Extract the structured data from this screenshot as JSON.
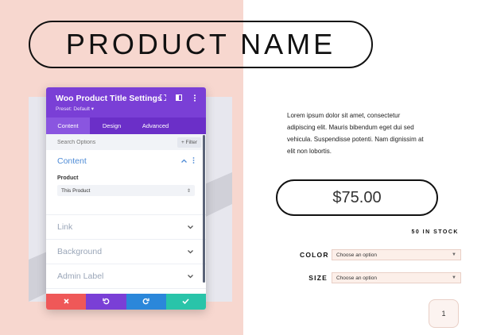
{
  "product": {
    "title": "PRODUCT NAME",
    "description": "Lorem ipsum dolor sit amet, consectetur adipiscing elit. Mauris bibendum eget dui sed vehicula. Suspendisse potenti. Nam dignissim at elit non lobortis.",
    "price": "$75.00",
    "stock": "50 IN STOCK",
    "variations": [
      {
        "label": "COLOR",
        "value": "Choose an option"
      },
      {
        "label": "SIZE",
        "value": "Choose an option"
      }
    ],
    "quantity": "1"
  },
  "panel": {
    "title": "Woo Product Title Settings",
    "preset": "Preset: Default ▾",
    "tabs": [
      "Content",
      "Design",
      "Advanced"
    ],
    "active_tab": "Content",
    "search_placeholder": "Search Options",
    "filter_label": "+ Filter",
    "content_section": {
      "title": "Content",
      "field_label": "Product",
      "field_value": "This Product"
    },
    "collapsed_sections": [
      "Link",
      "Background",
      "Admin Label"
    ]
  },
  "colors": {
    "accent_purple": "#7a3fd6",
    "discard": "#ef5858",
    "redo": "#2b87da",
    "save": "#29c4a9",
    "background_pink": "#f7d7cf"
  },
  "icons": {
    "header": [
      "expand-icon",
      "split-view-icon",
      "more-vertical-icon"
    ],
    "actions": [
      "close-icon",
      "undo-icon",
      "redo-icon",
      "check-icon"
    ]
  }
}
